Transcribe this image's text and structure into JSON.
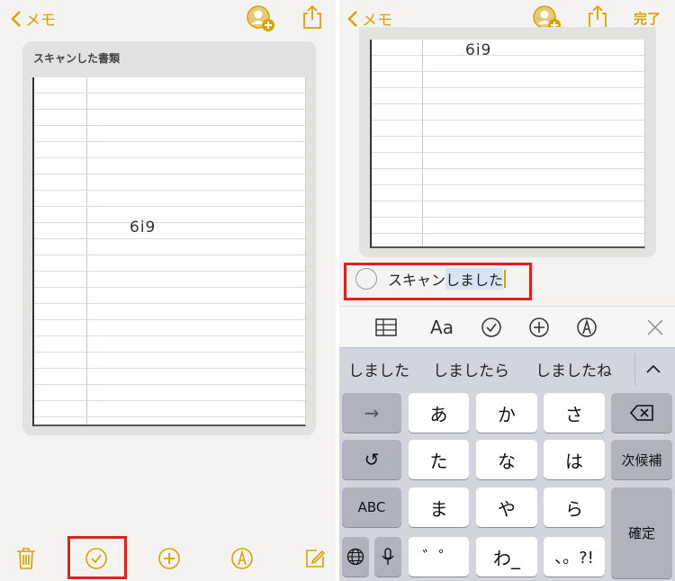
{
  "left": {
    "nav": {
      "back_label": "メモ"
    },
    "card": {
      "title": "スキャンした書類",
      "handwriting": "6i9"
    },
    "toolbar": [
      "trash-icon",
      "checklist-icon",
      "add-icon",
      "markup-icon",
      "compose-icon"
    ]
  },
  "right": {
    "nav": {
      "back_label": "メモ",
      "done_label": "完了"
    },
    "card": {
      "handwriting": "6i9"
    },
    "checklist_item": {
      "text_committed": "スキャン",
      "text_marked": "しました"
    },
    "keyboard_toolbar": {
      "format_label": "Aa"
    },
    "suggestions": [
      "しました",
      "しましたら",
      "しましたね"
    ],
    "keys": {
      "row1": [
        "→",
        "あ",
        "か",
        "さ"
      ],
      "row2": [
        "↺",
        "た",
        "な",
        "は",
        "次候補"
      ],
      "row3": [
        "ABC",
        "ま",
        "や",
        "ら"
      ],
      "row4": [
        "゛゜",
        "わ_",
        "、。?!"
      ],
      "confirm": "確定"
    }
  },
  "colors": {
    "accent": "#d9a300",
    "highlight": "#e0201b"
  }
}
